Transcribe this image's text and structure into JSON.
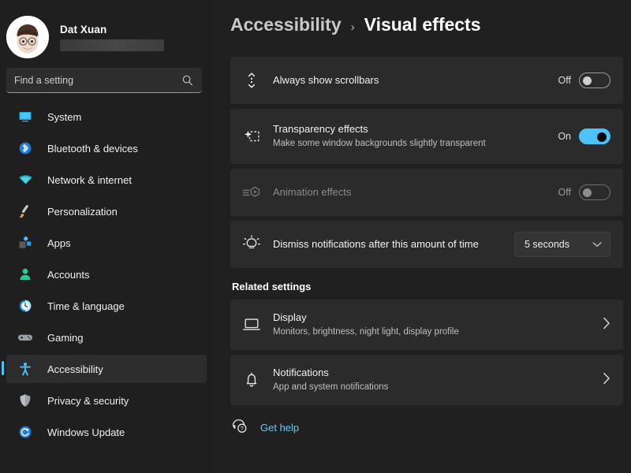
{
  "sidebar": {
    "profile": {
      "name": "Dat Xuan",
      "email_redacted": true,
      "avatar_icon": "user-avatar-memoji"
    },
    "search": {
      "placeholder": "Find a setting",
      "value": "",
      "icon": "search-icon"
    },
    "items": [
      {
        "label": "System",
        "icon": "system-icon",
        "selected": false
      },
      {
        "label": "Bluetooth & devices",
        "icon": "bluetooth-icon",
        "selected": false
      },
      {
        "label": "Network & internet",
        "icon": "wifi-icon",
        "selected": false
      },
      {
        "label": "Personalization",
        "icon": "paintbrush-icon",
        "selected": false
      },
      {
        "label": "Apps",
        "icon": "apps-icon",
        "selected": false
      },
      {
        "label": "Accounts",
        "icon": "account-icon",
        "selected": false
      },
      {
        "label": "Time & language",
        "icon": "clock-icon",
        "selected": false
      },
      {
        "label": "Gaming",
        "icon": "gamepad-icon",
        "selected": false
      },
      {
        "label": "Accessibility",
        "icon": "accessibility-icon",
        "selected": true
      },
      {
        "label": "Privacy & security",
        "icon": "shield-icon",
        "selected": false
      },
      {
        "label": "Windows Update",
        "icon": "update-icon",
        "selected": false
      }
    ]
  },
  "header": {
    "breadcrumb_parent": "Accessibility",
    "breadcrumb_separator": "›",
    "breadcrumb_current": "Visual effects"
  },
  "settings": [
    {
      "title": "Always show scrollbars",
      "description": "",
      "icon": "scrollbar-icon",
      "control": "toggle",
      "state_label": "Off",
      "state": "off",
      "disabled": false
    },
    {
      "title": "Transparency effects",
      "description": "Make some window backgrounds slightly transparent",
      "icon": "transparency-icon",
      "control": "toggle",
      "state_label": "On",
      "state": "on",
      "disabled": false
    },
    {
      "title": "Animation effects",
      "description": "",
      "icon": "animation-icon",
      "control": "toggle",
      "state_label": "Off",
      "state": "off",
      "disabled": true,
      "annotated": true
    },
    {
      "title": "Dismiss notifications after this amount of time",
      "description": "",
      "icon": "notification-timer-icon",
      "control": "dropdown",
      "selected_option": "5 seconds",
      "disabled": false
    }
  ],
  "related": {
    "section_title": "Related settings",
    "items": [
      {
        "title": "Display",
        "description": "Monitors, brightness, night light, display profile",
        "icon": "monitor-icon",
        "chevron": "chevron-right-icon"
      },
      {
        "title": "Notifications",
        "description": "App and system notifications",
        "icon": "bell-icon",
        "chevron": "chevron-right-icon"
      }
    ]
  },
  "footer": {
    "get_help_label": "Get help",
    "get_help_icon": "help-headset-icon"
  },
  "annotations": {
    "arrow": {
      "color": "#ff0000",
      "direction": "right",
      "points_to": "Animation effects toggle"
    },
    "highlight_box": {
      "color": "#ff0000",
      "target": "animation-effects-toggle"
    }
  },
  "colors": {
    "accent": "#4cc2ff",
    "link": "#74c7ec",
    "page_background": "#202020",
    "sidebar_background": "#1f1f1f",
    "card_background": "#2b2b2b",
    "annotation_red": "#ff0000"
  }
}
